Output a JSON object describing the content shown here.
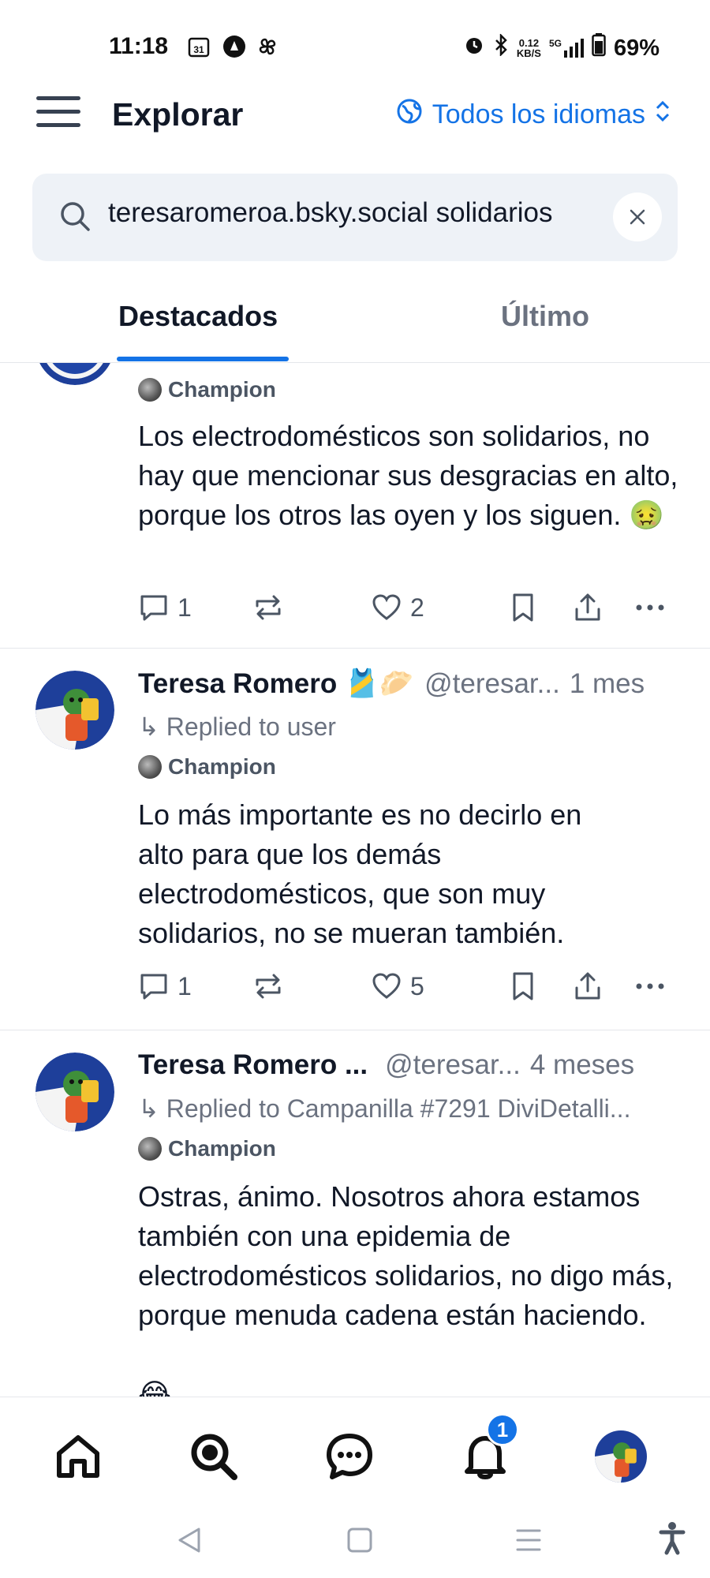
{
  "status_bar": {
    "time": "11:18",
    "calendar_day": "31",
    "net_speed_value": "0.12",
    "net_speed_unit": "KB/S",
    "network": "5G",
    "battery": "69%"
  },
  "header": {
    "title": "Explorar",
    "language_label": "Todos los idiomas"
  },
  "search": {
    "value": "teresaromeroa.bsky.social solidarios"
  },
  "tabs": {
    "featured": "Destacados",
    "latest": "Último"
  },
  "posts": [
    {
      "badge": "Champion",
      "text": "Los electrodomésticos son solidarios, no hay que mencionar sus desgracias en alto, porque los otros las oyen y los siguen. 🤢",
      "replies": "1",
      "likes": "2"
    },
    {
      "author": "Teresa Romero 🎽🥟",
      "handle": "@teresar...",
      "time": "1 mes",
      "reply_to": "↳ Replied to user",
      "badge": "Champion",
      "text": "Lo más importante es no decirlo en alto para que los demás electrodomésticos, que son muy solidarios, no se mueran también.",
      "replies": "1",
      "likes": "5"
    },
    {
      "author": "Teresa Romero ...",
      "handle": "@teresar...",
      "time": "4 meses",
      "reply_to": "↳ Replied to Campanilla #7291 DiviDetalli...",
      "badge": "Champion",
      "text": "Ostras, ánimo. Nosotros ahora estamos también con una epidemia de electrodomésticos solidarios, no digo más, porque menuda cadena están haciendo.",
      "trailing_emoji": "😂"
    }
  ],
  "bottom_nav": {
    "notification_count": "1"
  },
  "colors": {
    "accent": "#1473e6",
    "muted_text": "#6b7280",
    "search_bg": "#eef2f7"
  }
}
